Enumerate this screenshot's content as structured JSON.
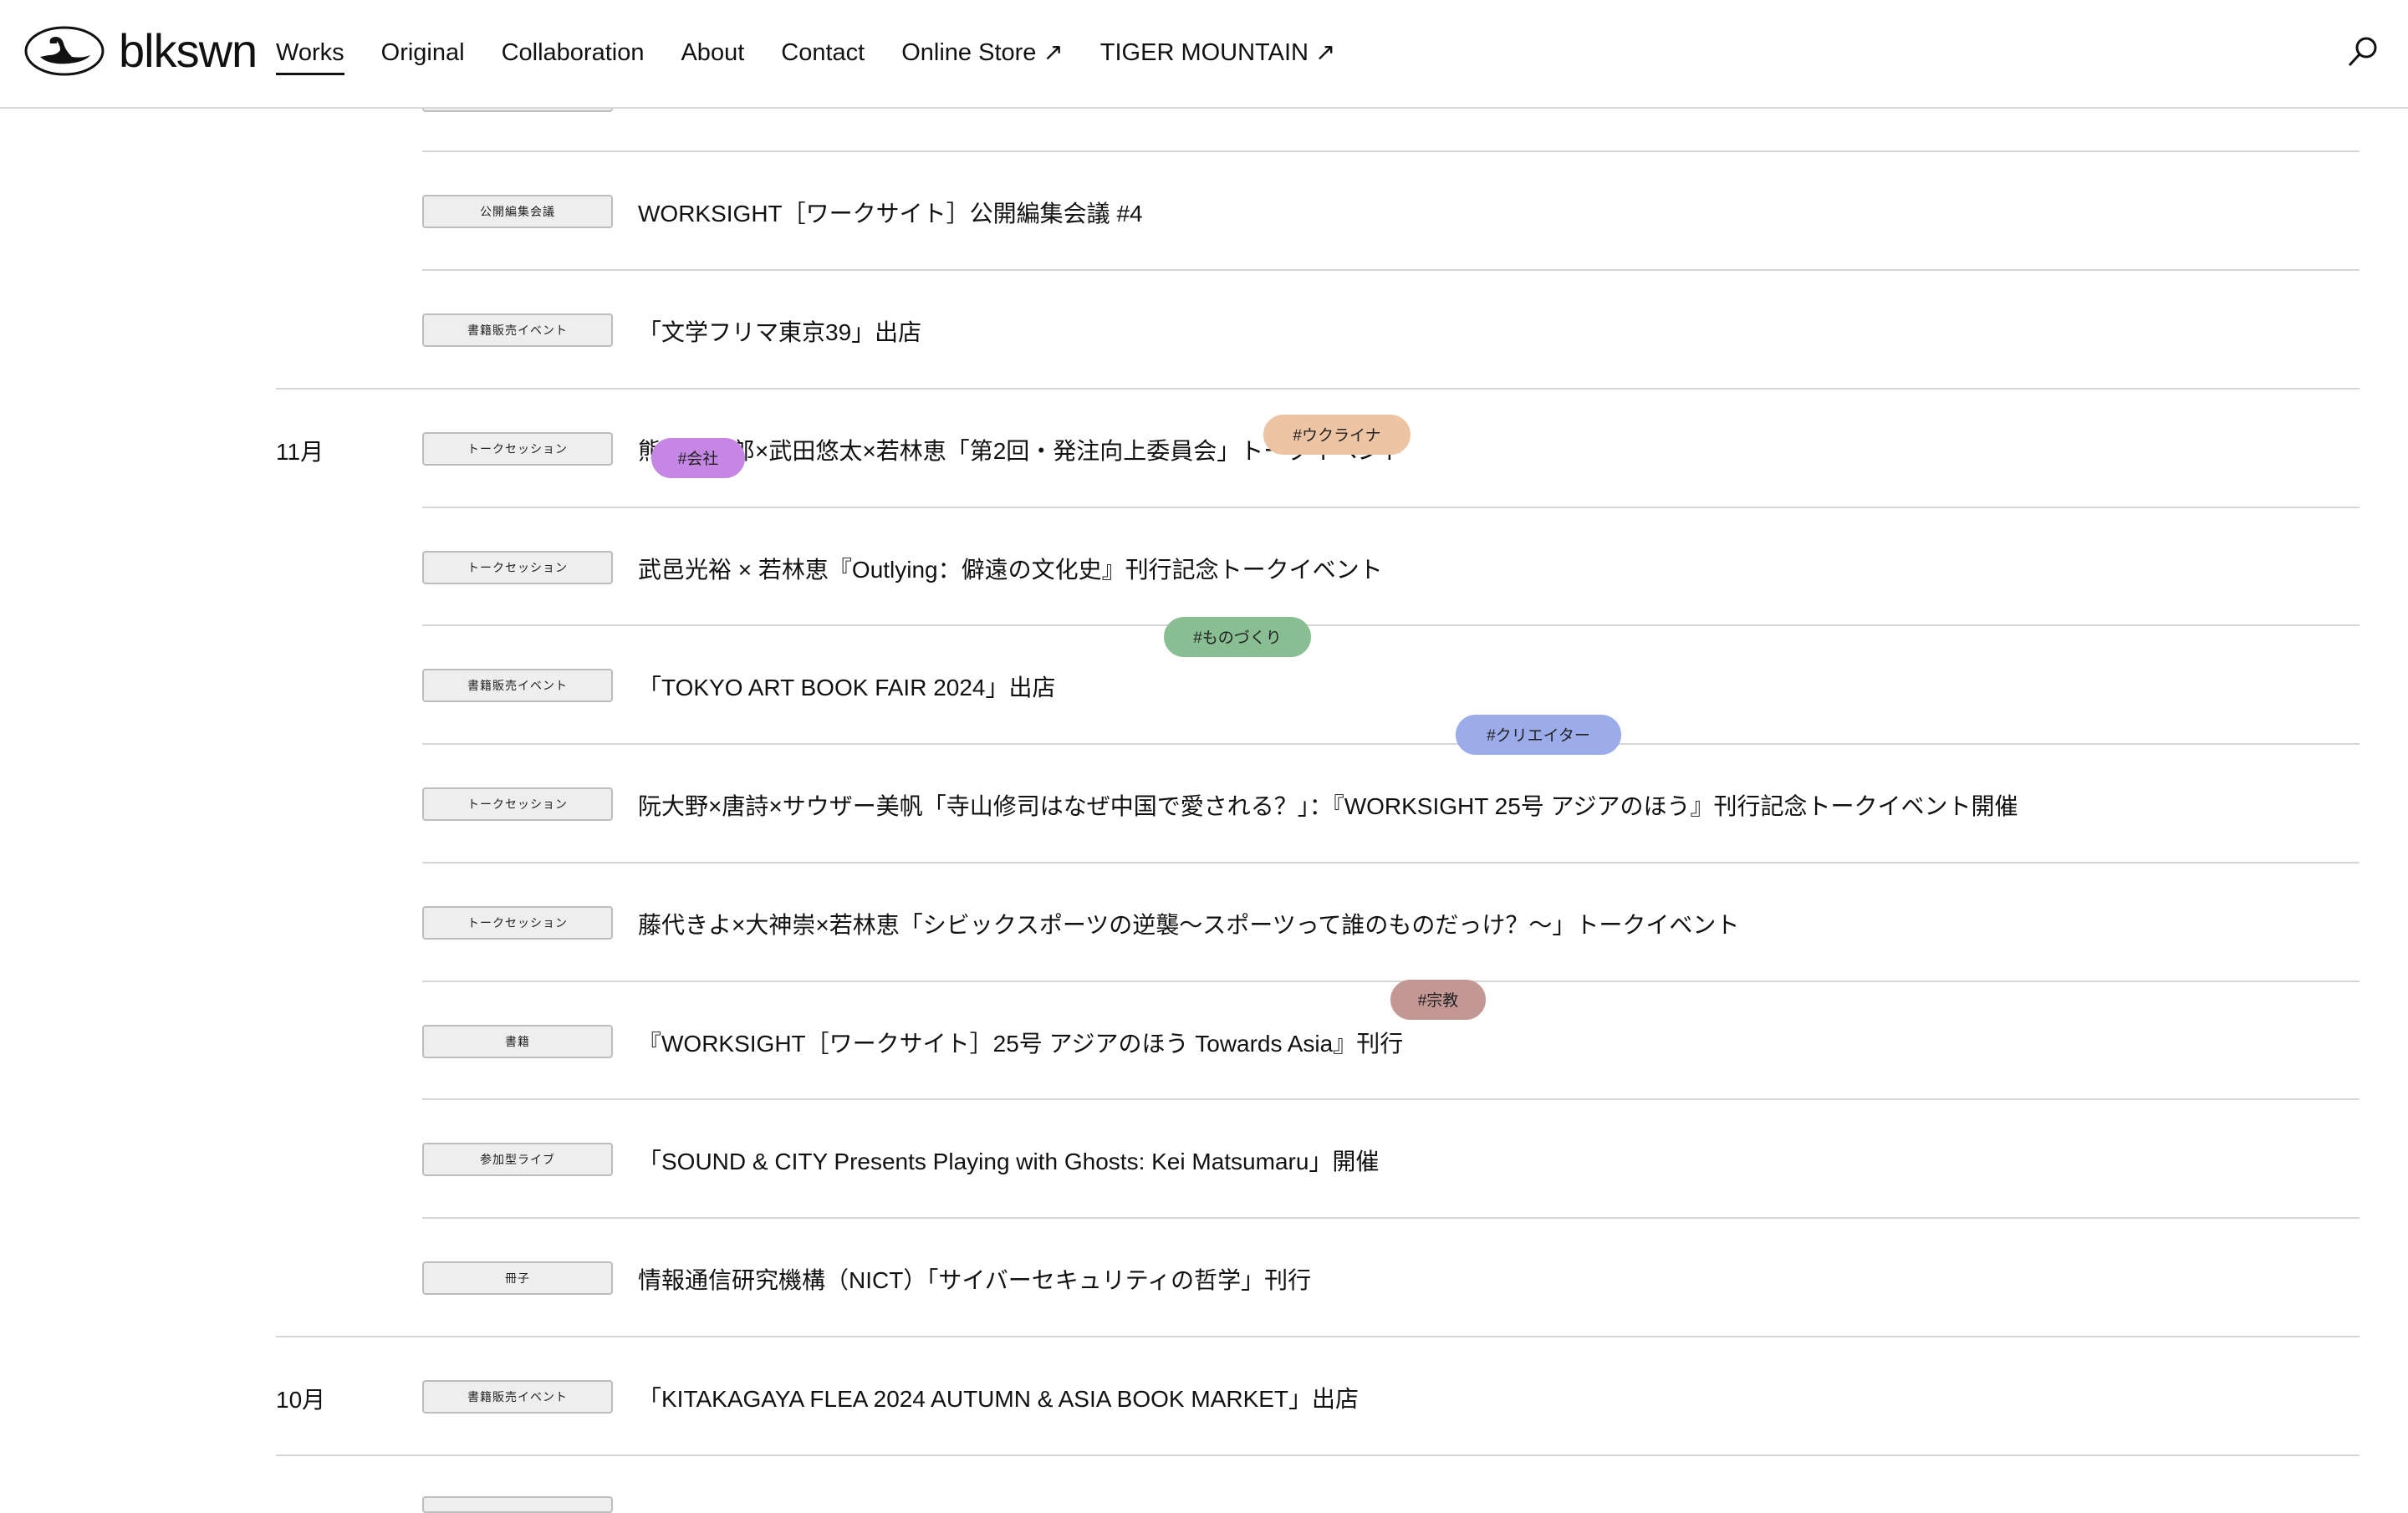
{
  "header": {
    "logo_text": "blkswn",
    "nav": [
      {
        "label": "Works"
      },
      {
        "label": "Original"
      },
      {
        "label": "Collaboration"
      },
      {
        "label": "About"
      },
      {
        "label": "Contact"
      },
      {
        "label": "Online Store ↗"
      },
      {
        "label": "TIGER MOUNTAIN ↗"
      }
    ]
  },
  "months": {
    "nov": "11月",
    "oct": "10月"
  },
  "rows": [
    {
      "badge": "公開編集会議",
      "title": "WORKSIGHT［ワークサイト］公開編集会議 #4"
    },
    {
      "badge": "書籍販売イベント",
      "title": "「文学フリマ東京39」出店"
    },
    {
      "badge": "トークセッション",
      "title": "熊谷晋一郎×武田悠太×若林恵「第2回・発注向上委員会」トークイベント"
    },
    {
      "badge": "トークセッション",
      "title": "武邑光裕 × 若林恵『Outlying：僻遠の文化史』刊行記念トークイベント"
    },
    {
      "badge": "書籍販売イベント",
      "title": "「TOKYO ART BOOK FAIR 2024」出店"
    },
    {
      "badge": "トークセッション",
      "title": "阮大野×唐詩×サウザー美帆「寺山修司はなぜ中国で愛される？」：『WORKSIGHT 25号 アジアのほう』刊行記念トークイベント開催"
    },
    {
      "badge": "トークセッション",
      "title": "藤代きよ×大神崇×若林恵「シビックスポーツの逆襲〜スポーツって誰のものだっけ？〜」トークイベント"
    },
    {
      "badge": "書籍",
      "title": "『WORKSIGHT［ワークサイト］25号 アジアのほう Towards Asia』刊行"
    },
    {
      "badge": "参加型ライブ",
      "title": "「SOUND & CITY Presents Playing with Ghosts: Kei Matsumaru」開催"
    },
    {
      "badge": "冊子",
      "title": "情報通信研究機構（NICT）「サイバーセキュリティの哲学」刊行"
    },
    {
      "badge": "書籍販売イベント",
      "title": "「KITAKAGAYA FLEA 2024 AUTUMN & ASIA BOOK MARKET」出店"
    }
  ],
  "tags": [
    {
      "label": "#ウクライナ",
      "color": "#f2c9a8"
    },
    {
      "label": "#会社",
      "color": "#c98ae8"
    },
    {
      "label": "#ものづくり",
      "color": "#8cc295"
    },
    {
      "label": "#クリエイター",
      "color": "#9fb0f0"
    },
    {
      "label": "#宗教",
      "color": "#c79a96"
    }
  ]
}
